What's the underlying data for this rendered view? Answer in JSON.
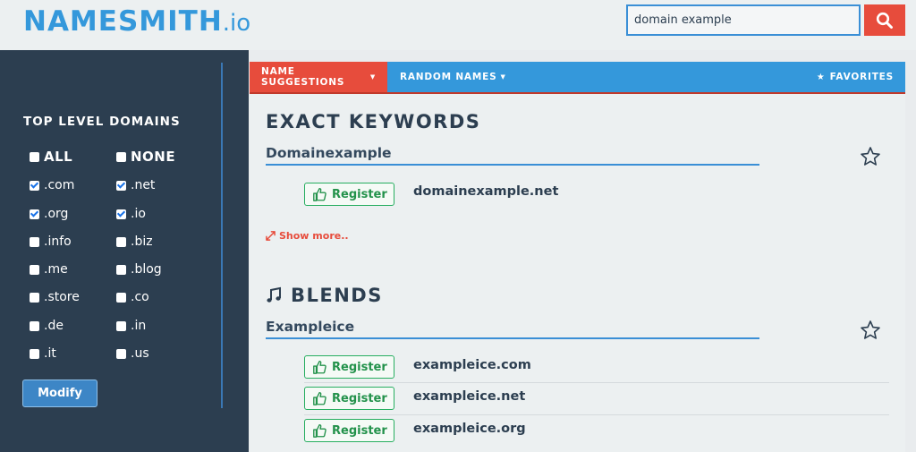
{
  "brand": {
    "name": "NAMESMITH",
    "tld": ".io"
  },
  "search": {
    "value": "domain example",
    "icon": "search-icon",
    "button_color": "#e74c3c"
  },
  "sidebar": {
    "title": "TOP LEVEL DOMAINS",
    "all_label": "ALL",
    "none_label": "NONE",
    "tlds": [
      {
        "label": ".com",
        "checked": true
      },
      {
        "label": ".net",
        "checked": true
      },
      {
        "label": ".org",
        "checked": true
      },
      {
        "label": ".io",
        "checked": true
      },
      {
        "label": ".info",
        "checked": false
      },
      {
        "label": ".biz",
        "checked": false
      },
      {
        "label": ".me",
        "checked": false
      },
      {
        "label": ".blog",
        "checked": false
      },
      {
        "label": ".store",
        "checked": false
      },
      {
        "label": ".co",
        "checked": false
      },
      {
        "label": ".de",
        "checked": false
      },
      {
        "label": ".in",
        "checked": false
      },
      {
        "label": ".it",
        "checked": false
      },
      {
        "label": ".us",
        "checked": false
      }
    ],
    "modify_label": "Modify"
  },
  "tabs": {
    "name_suggestions": "NAME SUGGESTIONS",
    "random_names": "RANDOM NAMES",
    "favorites": "FAVORITES"
  },
  "sections": [
    {
      "title": "EXACT KEYWORDS",
      "group": "Domainexample",
      "results": [
        {
          "action": "Register",
          "domain": "domainexample.net"
        }
      ],
      "show_more": "Show more.."
    },
    {
      "title": "BLENDS",
      "icon": "music-note-icon",
      "group": "Exampleice",
      "results": [
        {
          "action": "Register",
          "domain": "exampleice.com"
        },
        {
          "action": "Register",
          "domain": "exampleice.net"
        },
        {
          "action": "Register",
          "domain": "exampleice.org"
        }
      ]
    }
  ],
  "colors": {
    "brand_blue": "#3498db",
    "accent_red": "#e74c3c",
    "sidebar_bg": "#2c3e50",
    "register_green": "#27ae60"
  }
}
